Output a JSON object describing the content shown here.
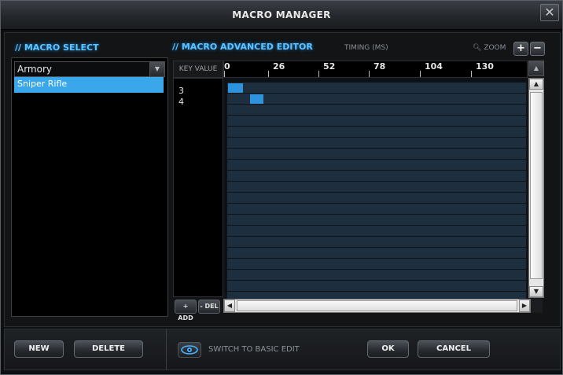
{
  "window": {
    "title": "MACRO MANAGER",
    "close_label": "✕"
  },
  "macro_select": {
    "title": "// MACRO SELECT",
    "dropdown_value": "Armory",
    "items": [
      "Sniper Rifle"
    ]
  },
  "editor": {
    "title": "// MACRO ADVANCED EDITOR",
    "timing_label": "TIMING (MS)",
    "zoom_label": "ZOOM",
    "zoom_in": "+",
    "zoom_out": "−",
    "key_value_header": "KEY VALUE",
    "ticks": [
      "0",
      "26",
      "52",
      "78",
      "104",
      "130"
    ],
    "key_values": [
      "3",
      "4"
    ],
    "add_label": "+ ADD",
    "del_label": "- DEL",
    "row_count": 20,
    "scroll_up": "▲",
    "scroll_down": "▼",
    "scroll_left": "◀",
    "scroll_right": "▶"
  },
  "footer": {
    "new_label": "NEW",
    "delete_label": "DELETE",
    "switch_label": "SWITCH TO BASIC EDIT",
    "ok_label": "OK",
    "cancel_label": "CANCEL"
  }
}
